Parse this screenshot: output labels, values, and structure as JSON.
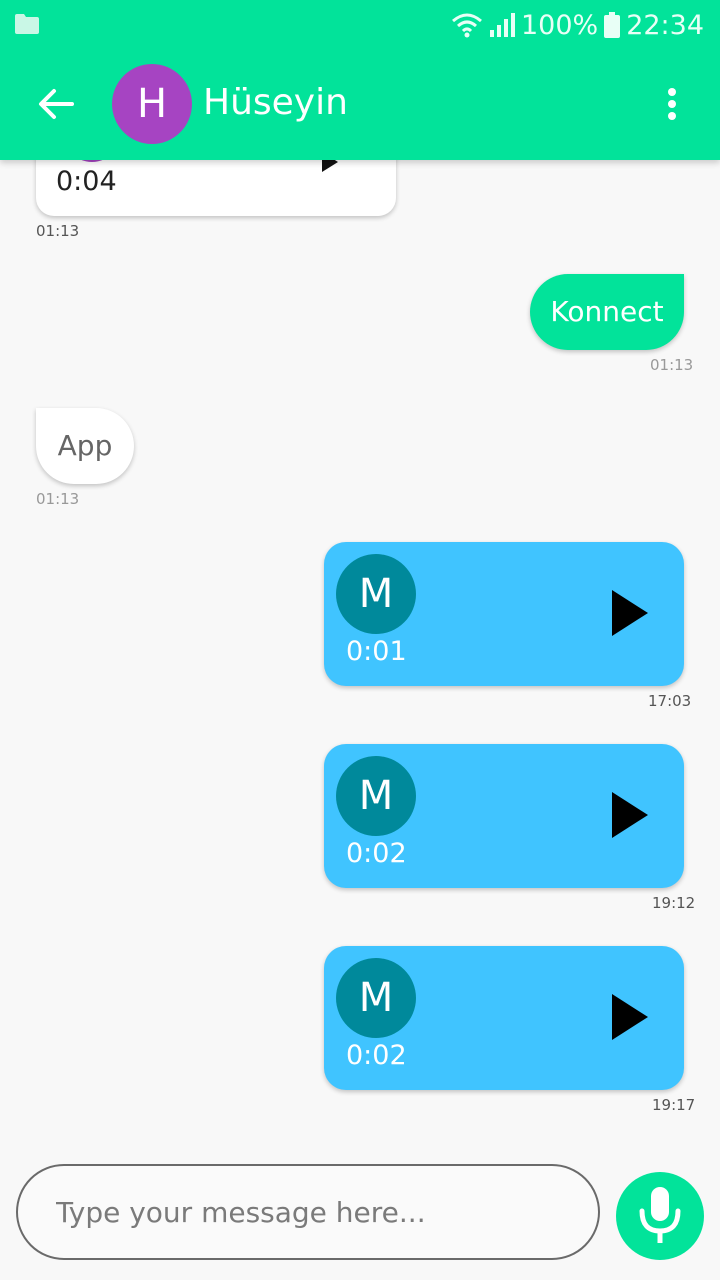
{
  "status_bar": {
    "battery": "100%",
    "time": "22:34",
    "icons": [
      "folder-icon",
      "wifi-icon",
      "signal-icon",
      "battery-icon"
    ]
  },
  "app_bar": {
    "back_icon": "arrow-left-icon",
    "avatar_letter": "H",
    "title": "Hüseyin",
    "menu_icon": "more-vert-icon"
  },
  "messages": [
    {
      "type": "voice",
      "side": "received",
      "duration": "0:04",
      "time": "01:13"
    },
    {
      "type": "text",
      "side": "sent",
      "text": "Konnect",
      "time": "01:13"
    },
    {
      "type": "text",
      "side": "received",
      "text": "App",
      "time": "01:13"
    },
    {
      "type": "voice",
      "side": "sent",
      "avatar_letter": "M",
      "duration": "0:01",
      "time": "17:03"
    },
    {
      "type": "voice",
      "side": "sent",
      "avatar_letter": "M",
      "duration": "0:02",
      "time": "19:12"
    },
    {
      "type": "voice",
      "side": "sent",
      "avatar_letter": "M",
      "duration": "0:02",
      "time": "19:17"
    }
  ],
  "composer": {
    "placeholder": "Type your message here...",
    "value": "",
    "mic_icon": "microphone-icon"
  },
  "colors": {
    "primary": "#02e39a",
    "voice_bubble": "#40c4ff",
    "voice_avatar": "#00899b",
    "contact_avatar": "#a644c2"
  }
}
